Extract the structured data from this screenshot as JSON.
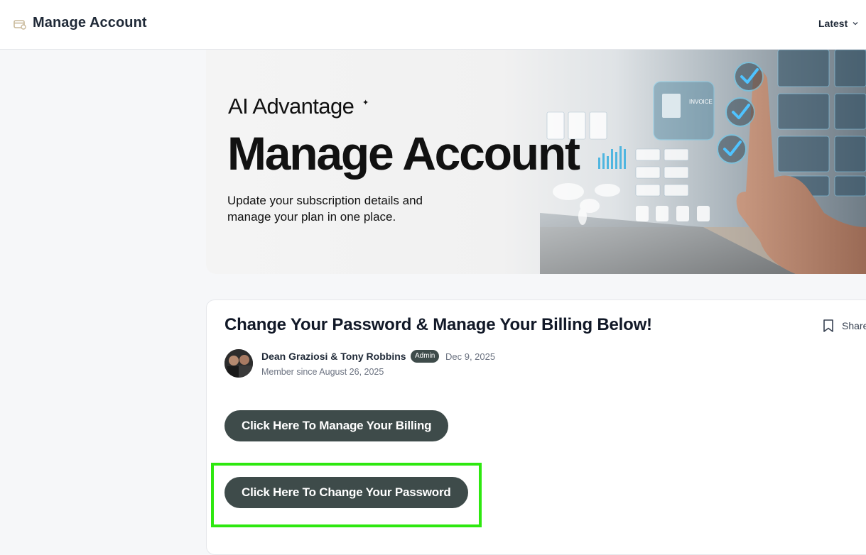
{
  "header": {
    "title": "Manage Account",
    "sort_label": "Latest"
  },
  "banner": {
    "brand": "AI Advantage",
    "headline": "Manage Account",
    "subtitle_line1": "Update your subscription details and",
    "subtitle_line2": "manage your plan in one place.",
    "invoice_label": "INVOICE"
  },
  "post": {
    "title": "Change Your Password & Manage Your Billing Below!",
    "share_label": "Share",
    "author": "Dean Graziosi & Tony Robbins",
    "badge": "Admin",
    "date": "Dec 9, 2025",
    "member_since": "Member since August 26, 2025",
    "buttons": {
      "billing": "Click Here To Manage Your Billing",
      "password": "Click Here To Change Your Password"
    }
  },
  "colors": {
    "button_bg": "#3e4b4a",
    "highlight": "#2ee80f",
    "page_bg": "#f6f7f9"
  }
}
